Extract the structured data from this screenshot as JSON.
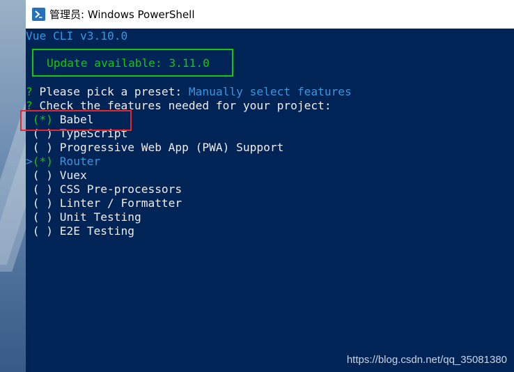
{
  "window": {
    "title": "管理员: Windows PowerShell",
    "icon": "powershell-icon"
  },
  "console": {
    "header": "Vue CLI v3.10.0",
    "update_notice": "Update available: 3.11.0",
    "preset_prompt": {
      "marker": "?",
      "question": " Please pick a preset: ",
      "answer": "Manually select features"
    },
    "features_prompt": {
      "marker": "?",
      "question": " Check the features needed for your project:"
    },
    "features": [
      {
        "checkbox": "(*)",
        "label": "Babel",
        "selected": true,
        "cursor": false
      },
      {
        "checkbox": "( )",
        "label": "TypeScript",
        "selected": false,
        "cursor": false
      },
      {
        "checkbox": "( )",
        "label": "Progressive Web App (PWA) Support",
        "selected": false,
        "cursor": false
      },
      {
        "checkbox": "(*)",
        "label": "Router",
        "selected": true,
        "cursor": true
      },
      {
        "checkbox": "( )",
        "label": "Vuex",
        "selected": false,
        "cursor": false
      },
      {
        "checkbox": "( )",
        "label": "CSS Pre-processors",
        "selected": false,
        "cursor": false
      },
      {
        "checkbox": "( )",
        "label": "Linter / Formatter",
        "selected": false,
        "cursor": false
      },
      {
        "checkbox": "( )",
        "label": "Unit Testing",
        "selected": false,
        "cursor": false
      },
      {
        "checkbox": "( )",
        "label": "E2E Testing",
        "selected": false,
        "cursor": false
      }
    ],
    "cursor_marker": ">"
  },
  "watermark": "https://blog.csdn.net/qq_35081380",
  "colors": {
    "background": "#012456",
    "text": "#eeedf0",
    "cyan": "#3a96dd",
    "green": "#16c60c",
    "highlight": "#e8262d"
  }
}
